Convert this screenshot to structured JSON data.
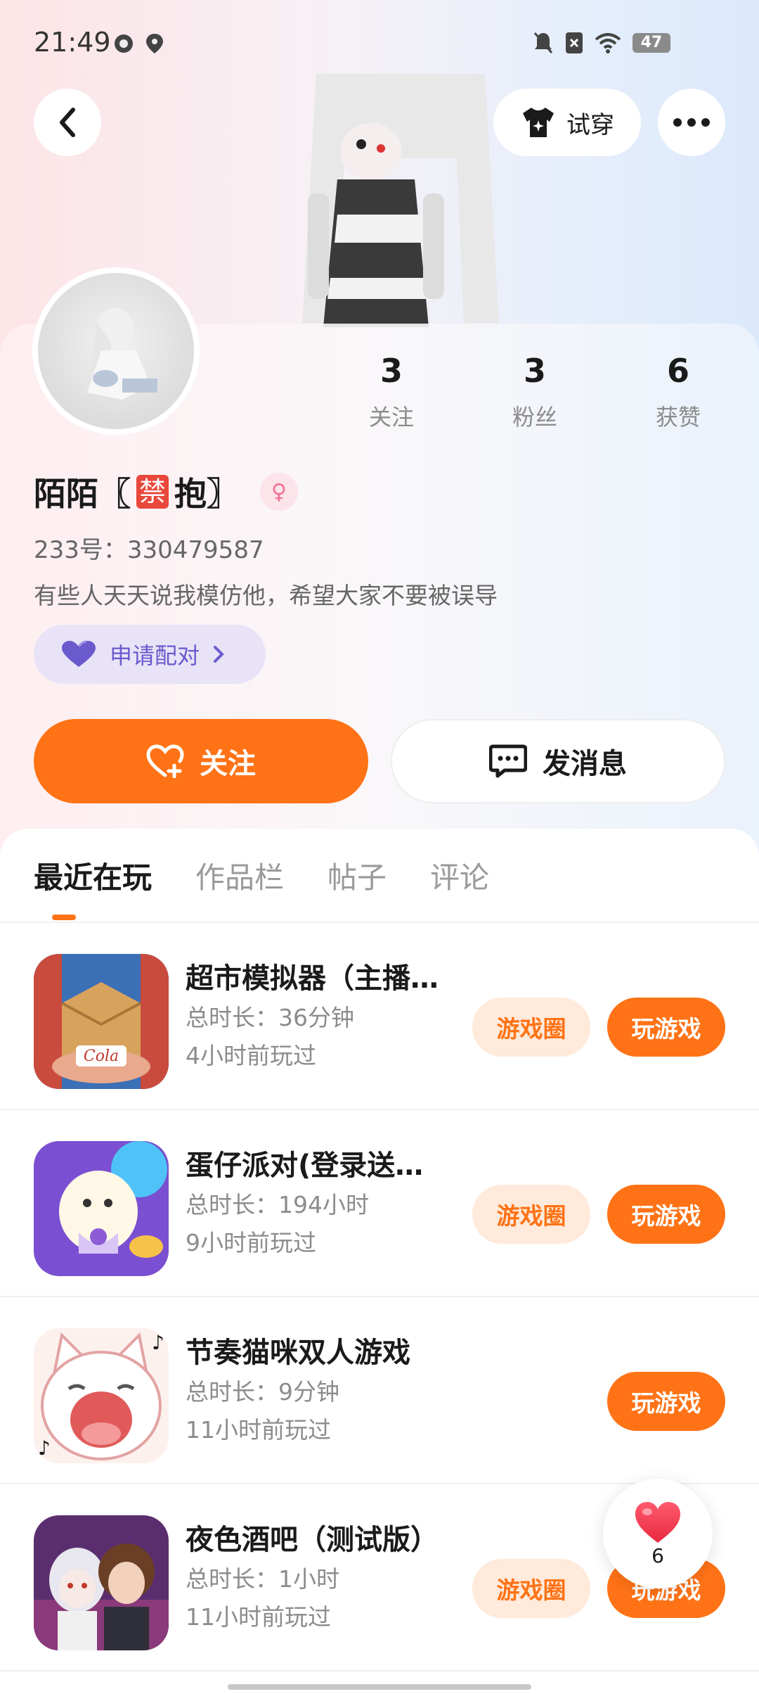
{
  "status_bar": {
    "time": "21:49",
    "battery": "47"
  },
  "header": {
    "tryon_label": "试穿"
  },
  "profile": {
    "stats": [
      {
        "value": "3",
        "label": "关注"
      },
      {
        "value": "3",
        "label": "粉丝"
      },
      {
        "value": "6",
        "label": "获赞"
      }
    ],
    "name_prefix": "陌陌〖",
    "name_badge": "禁",
    "name_suffix": "抱〗",
    "gender_symbol": "♀",
    "uid": "233号：330479587",
    "bio": "有些人天天说我模仿他，希望大家不要被误导",
    "pair_label": "申请配对"
  },
  "actions": {
    "follow_label": "关注",
    "message_label": "发消息"
  },
  "tabs": [
    {
      "label": "最近在玩"
    },
    {
      "label": "作品栏"
    },
    {
      "label": "帖子"
    },
    {
      "label": "评论"
    }
  ],
  "games": [
    {
      "title": "超市模拟器（主播…",
      "duration": "总时长：36分钟",
      "last_played": "4小时前玩过",
      "circle_label": "游戏圈",
      "play_label": "玩游戏"
    },
    {
      "title": "蛋仔派对(登录送…",
      "duration": "总时长：194小时",
      "last_played": "9小时前玩过",
      "circle_label": "游戏圈",
      "play_label": "玩游戏"
    },
    {
      "title": "节奏猫咪双人游戏",
      "duration": "总时长：9分钟",
      "last_played": "11小时前玩过",
      "circle_label": "",
      "play_label": "玩游戏"
    },
    {
      "title": "夜色酒吧（测试版）",
      "duration": "总时长：1小时",
      "last_played": "11小时前玩过",
      "circle_label": "游戏圈",
      "play_label": "玩游戏"
    }
  ],
  "like_fab": {
    "count": "6"
  },
  "colors": {
    "accent": "#ff7316",
    "accent_light": "#ffeadb",
    "pair_bg": "#e8e3f7",
    "pair_text": "#6a5acd"
  }
}
